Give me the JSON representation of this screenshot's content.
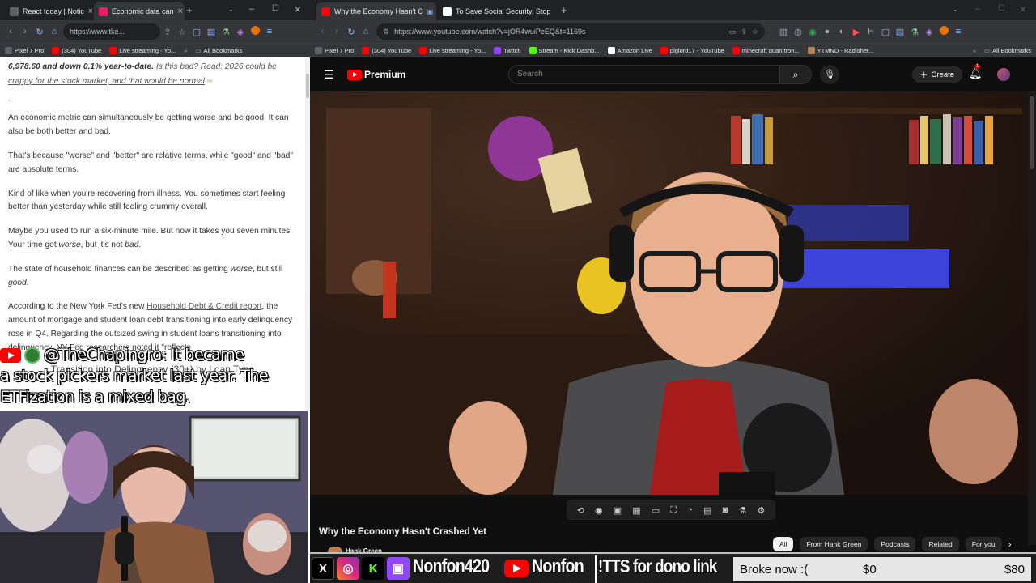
{
  "left_browser": {
    "tabs": [
      {
        "title": "React today | Notic",
        "active": false,
        "color": "#5f6368"
      },
      {
        "title": "Economic data can",
        "active": true,
        "color": "#e91e63"
      }
    ],
    "url": "https://www.tke...",
    "bookmarks": [
      {
        "label": "Pixel 7 Pro",
        "color": "#5f6368"
      },
      {
        "label": "(304) YouTube",
        "color": "#ff0000"
      },
      {
        "label": "Live streaming - Yo...",
        "color": "#ff0000"
      }
    ],
    "all_bookmarks": "All Bookmarks",
    "article": {
      "lead_bold": "6,978.60 and down 0.1% year-to-date.",
      "lead_q": " Is this bad? Read: ",
      "lead_link": "2026 could be crappy for the stock market, and that would be normal",
      "dash": "-",
      "p1": "An economic metric can simultaneously be getting worse and be good. It can also be both better and bad.",
      "p2": "That's because \"worse\" and \"better\" are relative terms, while \"good\" and \"bad\" are absolute terms.",
      "p3": "Kind of like when you're recovering from illness. You sometimes start feeling better than yesterday while still feeling crummy overall.",
      "p4a": "Maybe you used to run a six-minute mile. But now it takes you seven minutes. Your time got ",
      "p4b": "worse",
      "p4c": ", but it's not ",
      "p4d": "bad",
      "p4e": ".",
      "p5a": "The state of household finances can be described as getting ",
      "p5b": "worse",
      "p5c": ", but still ",
      "p5d": "good",
      "p5e": ".",
      "p6a": "According to the New York Fed's new ",
      "p6link": "Household Debt & Credit report",
      "p6b": ", the amount of mortgage and student loan debt transitioning into early delinquency rose in Q4. Regarding the outsized swing in student loans transitioning into delinquency, NY Fed researchers noted it \"reflects",
      "chart_caption": "Transition into Delinquency (30+) by Loan Type"
    },
    "chat": {
      "username": "@TheChapingro:",
      "message_1": " It became",
      "message_2": "a stock pickers market last year. The",
      "message_3": "ETFization is a mixed bag."
    }
  },
  "right_browser": {
    "tabs": [
      {
        "title": "Why the Economy Hasn't C",
        "active": true,
        "color": "#ff0000"
      },
      {
        "title": "To Save Social Security, Stop Si",
        "active": false,
        "color": "#ffffff"
      }
    ],
    "url": "https://www.youtube.com/watch?v=jOR4wuiPeEQ&t=1169s",
    "bookmarks": [
      {
        "label": "Pixel 7 Pro",
        "color": "#5f6368"
      },
      {
        "label": "(304) YouTube",
        "color": "#ff0000"
      },
      {
        "label": "Live streaming - Yo...",
        "color": "#ff0000"
      },
      {
        "label": "Twitch",
        "color": "#9146ff"
      },
      {
        "label": "Stream - Kick Dashb...",
        "color": "#53fc18"
      },
      {
        "label": "Amazon Live",
        "color": "#ffffff"
      },
      {
        "label": "piglord17 - YouTube",
        "color": "#ff0000"
      },
      {
        "label": "minecraft quan tron...",
        "color": "#ff0000"
      },
      {
        "label": "YTMND - Radioher...",
        "color": "#b0855a"
      }
    ],
    "all_bookmarks": "All Bookmarks",
    "youtube": {
      "logo_text": "Premium",
      "search_placeholder": "Search",
      "create_label": "Create",
      "notification_count": "1",
      "video_title": "Why the Economy Hasn't Crashed Yet",
      "channel": "Hank Green",
      "chips": [
        "All",
        "From Hank Green",
        "Podcasts",
        "Related",
        "For you"
      ]
    }
  },
  "stream_bar": {
    "handle_1": "Nonfon420",
    "handle_2": "Nonfon",
    "tts": "!TTS for dono link",
    "goal_label": "Broke now :(",
    "goal_current": "$0",
    "goal_target": "$80",
    "progress": 0
  }
}
